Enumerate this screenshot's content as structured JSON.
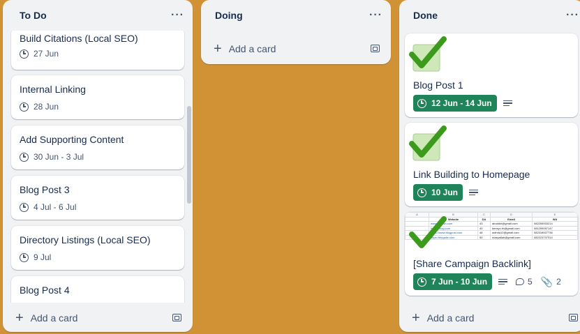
{
  "lists": {
    "todo": {
      "title": "To Do",
      "menu": "···",
      "cards": [
        {
          "title": "Build Citations (Local SEO)",
          "date": "27 Jun"
        },
        {
          "title": "Internal Linking",
          "date": "28 Jun"
        },
        {
          "title": "Add Supporting Content",
          "date": "30 Jun - 3 Jul"
        },
        {
          "title": "Blog Post 3",
          "date": "4 Jul - 6 Jul"
        },
        {
          "title": "Directory Listings (Local SEO)",
          "date": "9 Jul"
        },
        {
          "title": "Blog Post 4",
          "date": ""
        }
      ],
      "add_label": "Add a card"
    },
    "doing": {
      "title": "Doing",
      "menu": "···",
      "add_label": "Add a card"
    },
    "done": {
      "title": "Done",
      "menu": "···",
      "cards": [
        {
          "title": "Blog Post 1",
          "date": "12 Jun - 14 Jun"
        },
        {
          "title": "Link Building to Homepage",
          "date": "10 Jun"
        },
        {
          "title": "[Share Campaign Backlink]",
          "date": "7 Jun - 10 Jun",
          "comments": "5",
          "attachments": "2"
        }
      ],
      "add_label": "Add a card"
    }
  },
  "sheet": {
    "col_letters": [
      "A",
      "B",
      "C",
      "D",
      "E"
    ],
    "headers": [
      "Website",
      "DA",
      "Email",
      "WA"
    ],
    "rows": [
      [
        "www.domain.com",
        "43",
        "abuddin@gmail.com",
        "082255933214"
      ],
      [
        "https://blog.com",
        "40",
        "kensyo.rh@gmail.com",
        "081299097147"
      ],
      [
        "https://www.blogpost.com",
        "48",
        "adinda12@gmail.com",
        "082318927736"
      ],
      [
        "https://blogsite.com",
        "50",
        "mazyatlah@gmail.com",
        "082223737314"
      ]
    ]
  },
  "colors": {
    "board_bg": "#d19235",
    "list_bg": "#f1f2f4",
    "date_badge_complete": "#1f845a",
    "check_green": "#3c9a1c"
  },
  "icons": {
    "date": "clock-icon",
    "add": "plus-icon",
    "template": "card-template-icon",
    "description": "description-icon",
    "comments": "comment-icon",
    "attachments": "paperclip-icon",
    "cover": "green-check-icon"
  }
}
